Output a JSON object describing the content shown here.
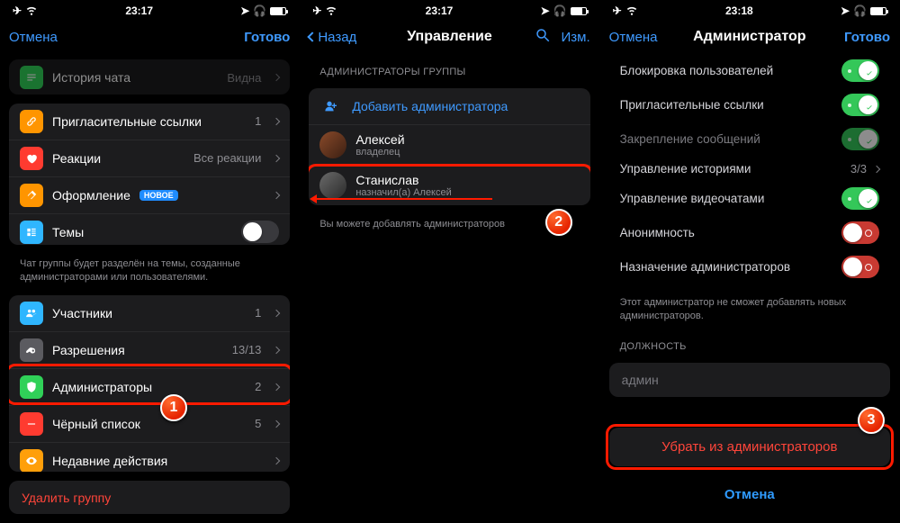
{
  "status": {
    "time1": "23:17",
    "time2": "23:17",
    "time3": "23:18"
  },
  "s1": {
    "nav": {
      "cancel": "Отмена",
      "done": "Готово"
    },
    "rows": {
      "history": {
        "label": "История чата",
        "value": "Видна"
      },
      "invite": {
        "label": "Пригласительные ссылки",
        "value": "1"
      },
      "reactions": {
        "label": "Реакции",
        "value": "Все реакции"
      },
      "appearance": {
        "label": "Оформление",
        "badge": "НОВОЕ"
      },
      "topics": {
        "label": "Темы"
      },
      "members": {
        "label": "Участники",
        "value": "1"
      },
      "permissions": {
        "label": "Разрешения",
        "value": "13/13"
      },
      "admins": {
        "label": "Администраторы",
        "value": "2"
      },
      "blacklist": {
        "label": "Чёрный список",
        "value": "5"
      },
      "recent": {
        "label": "Недавние действия"
      }
    },
    "footer_topics": "Чат группы будет разделён на темы, созданные администраторами или пользователями.",
    "delete_group": "Удалить группу"
  },
  "s2": {
    "nav": {
      "back": "Назад",
      "title": "Управление",
      "edit": "Изм."
    },
    "header": "АДМИНИСТРАТОРЫ ГРУППЫ",
    "add_admin": "Добавить администратора",
    "admins": [
      {
        "name": "Алексей",
        "sub": "владелец"
      },
      {
        "name": "Станислав",
        "sub": "назначил(а) Алексей"
      }
    ],
    "footer": "Вы можете добавлять администраторов"
  },
  "s3": {
    "nav": {
      "cancel": "Отмена",
      "title": "Администратор",
      "done": "Готово"
    },
    "perms": {
      "block": "Блокировка пользователей",
      "invite": "Пригласительные ссылки",
      "pin": "Закрепление сообщений",
      "stories": {
        "label": "Управление историями",
        "value": "3/3"
      },
      "video": "Управление видеочатами",
      "anon": "Анонимность",
      "promote": "Назначение администраторов"
    },
    "perm_footer": "Этот администратор не сможет добавлять новых администраторов.",
    "role_header": "ДОЛЖНОСТЬ",
    "role_value": "админ",
    "remove": "Убрать из администраторов",
    "cancel_btn": "Отмена"
  }
}
